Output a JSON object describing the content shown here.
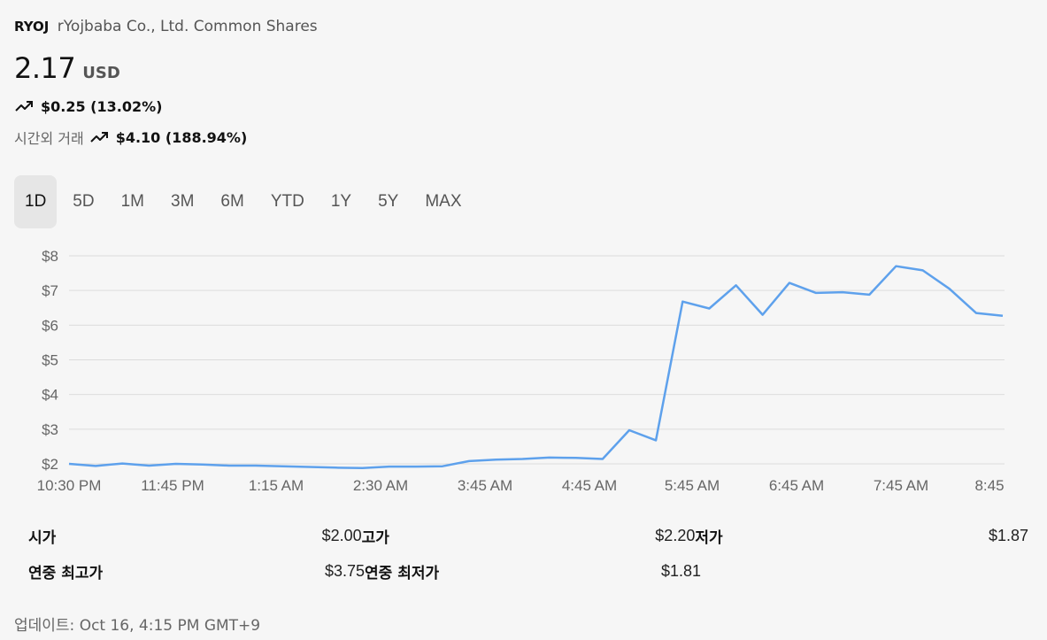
{
  "header": {
    "ticker": "RYOJ",
    "company": "rYojbaba Co., Ltd. Common Shares"
  },
  "quote": {
    "price": "2.17",
    "currency": "USD",
    "change": "$0.25 (13.02%)",
    "after_hours_label": "시간외 거래",
    "after_hours_change": "$4.10 (188.94%)",
    "trend_icon": "trending-up-icon"
  },
  "tabs": [
    "1D",
    "5D",
    "1M",
    "3M",
    "6M",
    "YTD",
    "1Y",
    "5Y",
    "MAX"
  ],
  "active_tab": "1D",
  "chart_data": {
    "type": "line",
    "color": "#5ea1ec",
    "grid": true,
    "ylim": [
      2,
      8
    ],
    "y_ticks": [
      "$2",
      "$3",
      "$4",
      "$5",
      "$6",
      "$7",
      "$8"
    ],
    "x_ticks": [
      "10:30 PM",
      "11:45 PM",
      "1:15 AM",
      "2:30 AM",
      "3:45 AM",
      "4:45 AM",
      "5:45 AM",
      "6:45 AM",
      "7:45 AM",
      "8:45"
    ],
    "series": [
      {
        "values": [
          2.0,
          1.94,
          2.01,
          1.95,
          2.0,
          1.98,
          1.95,
          1.95,
          1.93,
          1.91,
          1.89,
          1.88,
          1.92,
          1.92,
          1.93,
          2.08,
          2.12,
          2.14,
          2.18,
          2.17,
          2.14,
          2.97,
          2.68,
          6.68,
          6.48,
          7.15,
          6.3,
          7.22,
          6.93,
          6.95,
          6.88,
          7.7,
          7.58,
          7.05,
          6.35,
          6.27
        ]
      }
    ]
  },
  "stats": {
    "open_label": "시가",
    "open_value": "$2.00",
    "high_label": "고가",
    "high_value": "$2.20",
    "low_label": "저가",
    "low_value": "$1.87",
    "year_high_label": "연중 최고가",
    "year_high_value": "$3.75",
    "year_low_label": "연중 최저가",
    "year_low_value": "$1.81"
  },
  "updated": "업데이트: Oct 16, 4:15 PM GMT+9"
}
